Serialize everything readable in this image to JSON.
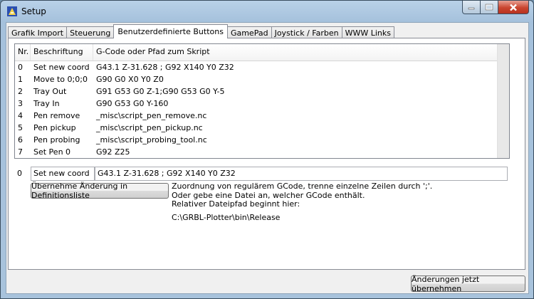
{
  "window": {
    "title": "Setup"
  },
  "tabs": [
    {
      "label": "Grafik Import"
    },
    {
      "label": "Steuerung"
    },
    {
      "label": "Benutzerdefinierte Buttons"
    },
    {
      "label": "GamePad"
    },
    {
      "label": "Joystick / Farben"
    },
    {
      "label": "WWW Links"
    }
  ],
  "grid": {
    "headers": [
      "Nr.",
      "Beschriftung",
      "G-Code oder Pfad zum Skript"
    ],
    "rows": [
      {
        "nr": "0",
        "label": "Set new coord",
        "code": "G43.1 Z-31.628 ; G92 X140 Y0 Z32"
      },
      {
        "nr": "1",
        "label": "Move to 0;0;0",
        "code": "G90 G0 X0 Y0 Z0"
      },
      {
        "nr": "2",
        "label": "Tray Out",
        "code": "G91 G53 G0 Z-1;G90 G53 G0 Y-5"
      },
      {
        "nr": "3",
        "label": "Tray In",
        "code": "G90 G53 G0 Y-160"
      },
      {
        "nr": "4",
        "label": "Pen remove",
        "code": "_misc\\script_pen_remove.nc"
      },
      {
        "nr": "5",
        "label": "Pen pickup",
        "code": "_misc\\script_pen_pickup.nc"
      },
      {
        "nr": "6",
        "label": "Pen probing",
        "code": "_misc\\script_probing_tool.nc"
      },
      {
        "nr": "7",
        "label": "Set Pen 0",
        "code": "G92 Z25"
      }
    ]
  },
  "editor": {
    "index": "0",
    "name_value": "Set new coord",
    "code_value": "G43.1 Z-31.628 ; G92 X140 Y0 Z32",
    "apply_label": "Übernehme Änderung in Definitionsliste"
  },
  "info": {
    "line1": "Zuordnung von regulärem GCode, trenne einzelne Zeilen durch ';'.",
    "line2": "Oder gebe eine Datei an, welcher GCode enthält.",
    "line3": "Relativer Dateipfad beginnt hier:",
    "path": "C:\\GRBL-Plotter\\bin\\Release"
  },
  "footer": {
    "save_label": "Änderungen jetzt übernehmen"
  }
}
